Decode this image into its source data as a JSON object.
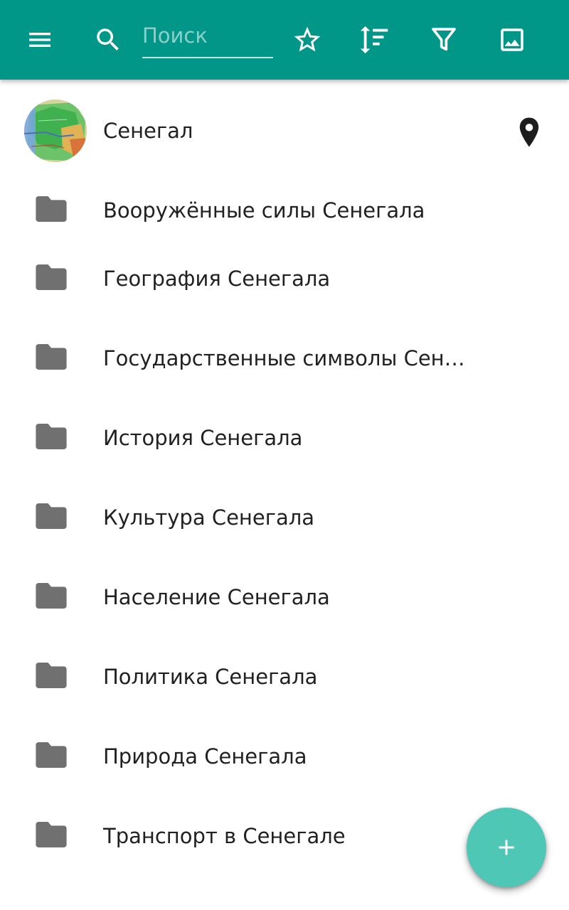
{
  "appbar": {
    "background_color": "#009688",
    "menu_icon": "menu-icon",
    "search_icon": "search-icon",
    "search_placeholder": "Поиск",
    "search_value": "",
    "actions": [
      {
        "icon": "star-outline-icon"
      },
      {
        "icon": "sort-icon"
      },
      {
        "icon": "filter-icon"
      },
      {
        "icon": "image-icon"
      }
    ]
  },
  "header_item": {
    "title": "Сенегал",
    "thumbnail": "map-thumbnail",
    "action_icon": "location-pin-icon"
  },
  "categories": [
    {
      "label": "Вооружённые силы Сенегала",
      "icon": "folder-icon"
    },
    {
      "label": "География Сенегала",
      "icon": "folder-icon"
    },
    {
      "label": "Государственные символы Сенегала",
      "icon": "folder-icon"
    },
    {
      "label": "История Сенегала",
      "icon": "folder-icon"
    },
    {
      "label": "Культура Сенегала",
      "icon": "folder-icon"
    },
    {
      "label": "Население Сенегала",
      "icon": "folder-icon"
    },
    {
      "label": "Политика Сенегала",
      "icon": "folder-icon"
    },
    {
      "label": "Природа Сенегала",
      "icon": "folder-icon"
    },
    {
      "label": "Транспорт в Сенегале",
      "icon": "folder-icon"
    }
  ],
  "fab": {
    "icon": "plus-icon",
    "color": "#4fc7b7"
  }
}
